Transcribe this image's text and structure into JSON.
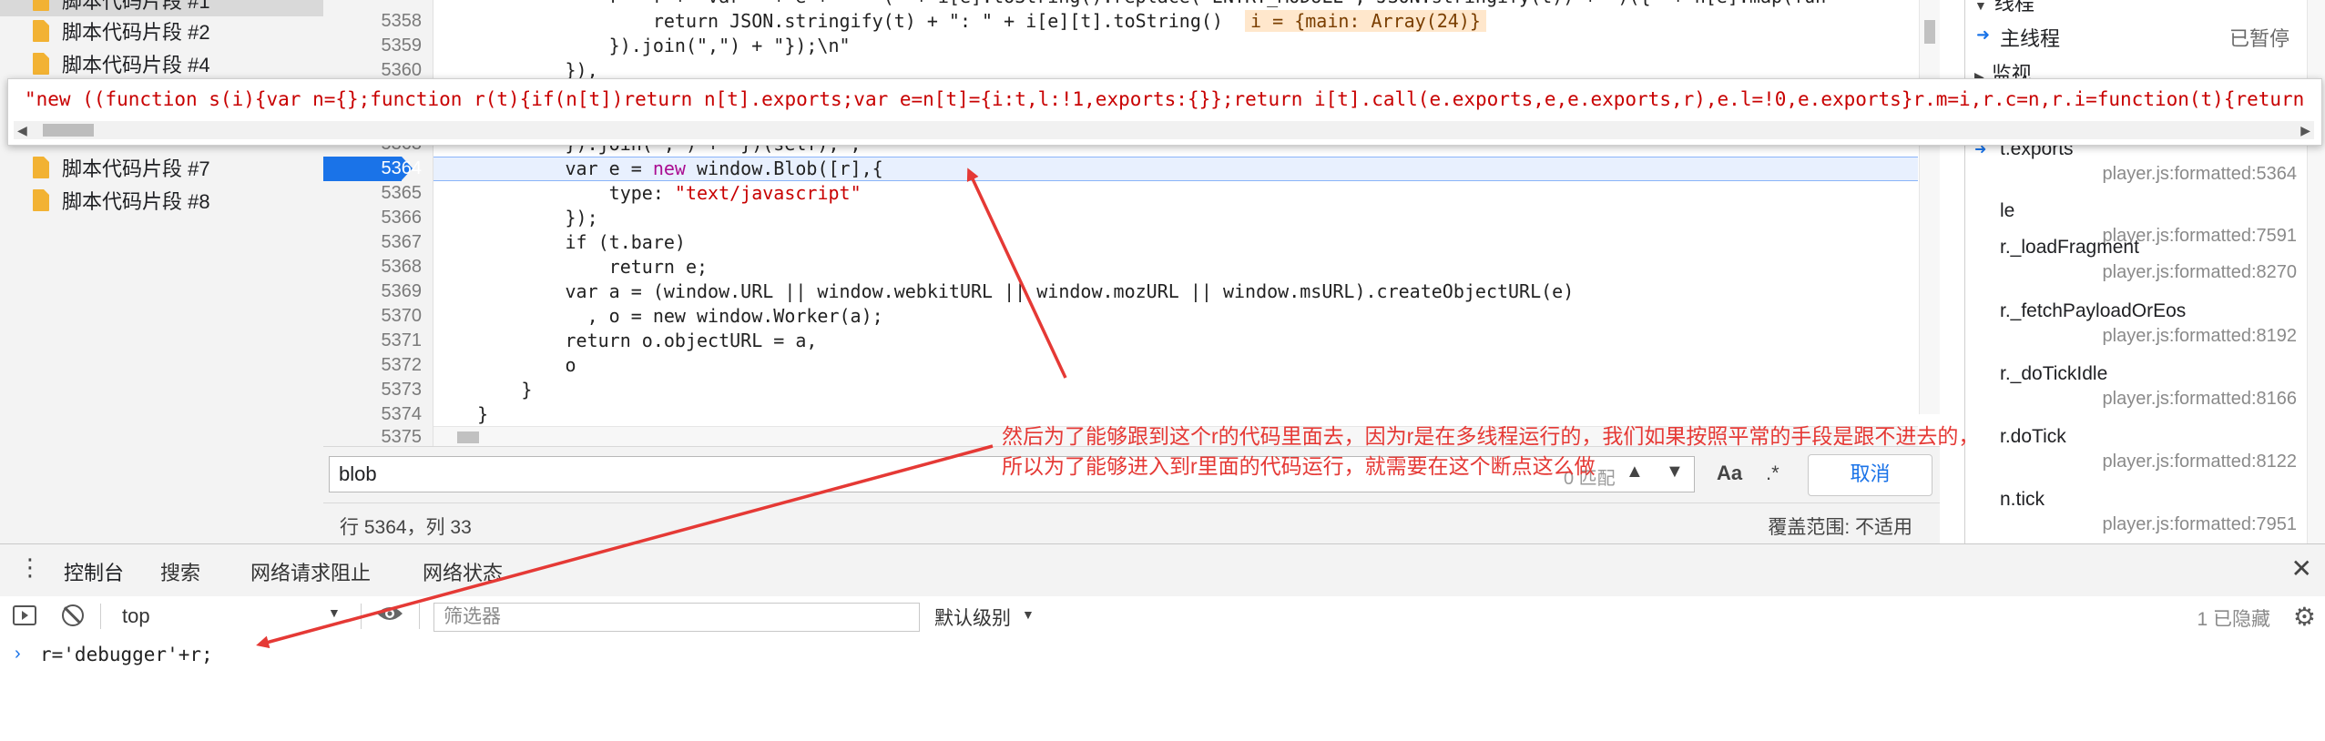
{
  "file_tree": {
    "items": [
      {
        "label": "脚本代码片段 #1"
      },
      {
        "label": "脚本代码片段 #2"
      },
      {
        "label": "脚本代码片段 #4"
      },
      {
        "label": "脚本代码片段 #7"
      },
      {
        "label": "脚本代码片段 #8"
      }
    ]
  },
  "editor": {
    "line_numbers": [
      "5358",
      "5359",
      "5360",
      "5363",
      "5364",
      "5365",
      "5366",
      "5367",
      "5368",
      "5369",
      "5370",
      "5371",
      "5372",
      "5373",
      "5374",
      "5375"
    ],
    "lines": {
      "l5357": "                r = r + 'var ' + e + ' = (' + i[e].toString().replace(\"ENTRY_MODULE\", JSON.stringify(t)) + ')({' + n[e].map(fun",
      "l5358_a": "                    return JSON.stringify(t) + \": \" + i[e][t].toString()",
      "l5358_hint": "i = {main: Array(24)}",
      "l5359": "                }).join(\",\") + \"});\\n\"",
      "l5360": "            }),",
      "l5363": "            }).join(\",\") + \"})(self);\";",
      "l5364_a": "            var e = ",
      "l5364_kw": "new",
      "l5364_b": " window.Blob([r],{",
      "l5365_a": "                type: ",
      "l5365_str": "\"text/javascript\"",
      "l5366": "            });",
      "l5367": "            if (t.bare)",
      "l5368": "                return e;",
      "l5369": "            var a = (window.URL || window.webkitURL || window.mozURL || window.msURL).createObjectURL(e)",
      "l5370": "              , o = new window.Worker(a);",
      "l5371": "            return o.objectURL = a,",
      "l5372": "            o",
      "l5373": "        }",
      "l5374": "    }"
    },
    "breakpoint_line": "5364"
  },
  "tooltip": {
    "text": "\"new ((function s(i){var n={};function r(t){if(n[t])return n[t].exports;var e=n[t]={i:t,l:!1,exports:{}};return i[t].call(e.exports,e,e.exports,r),e.l=!0,e.exports}r.m=i,r.c=n,r.i=function(t){return t},r"
  },
  "search": {
    "value": "blob",
    "count": "0 匹配",
    "match_case": "Aa",
    "regex": ".*",
    "cancel": "取消"
  },
  "status": {
    "cursor": "行 5364，列 33",
    "coverage": "覆盖范围: 不适用"
  },
  "debug_panel": {
    "threads_header": "线程",
    "main_thread": "主线程",
    "main_status": "已暂停",
    "watch_header": "监视",
    "frames": [
      {
        "name": "t.exports",
        "loc": "player.js:formatted:5364"
      },
      {
        "name": "le",
        "loc": "player.js:formatted:7591"
      },
      {
        "name": "r._loadFragment",
        "loc": "player.js:formatted:8270"
      },
      {
        "name": "r._fetchPayloadOrEos",
        "loc": "player.js:formatted:8192"
      },
      {
        "name": "r._doTickIdle",
        "loc": "player.js:formatted:8166"
      },
      {
        "name": "r.doTick",
        "loc": "player.js:formatted:8122"
      },
      {
        "name": "n.tick",
        "loc": "player.js:formatted:7951"
      }
    ]
  },
  "drawer": {
    "tabs": [
      "控制台",
      "搜索",
      "网络请求阻止",
      "网络状态"
    ],
    "active_tab": 0
  },
  "console": {
    "context": "top",
    "filter_placeholder": "筛选器",
    "level": "默认级别",
    "hidden": "1 已隐藏",
    "input": "r='debugger'+r;"
  },
  "annotation": {
    "text": "然后为了能够跟到这个r的代码里面去，因为r是在多线程运行的，我们如果按照平常的手段是跟不进去的，所以为了能够进入到r里面的代码运行，就需要在这个断点这么做"
  },
  "colors": {
    "accent": "#1a73e8",
    "annotation": "#e53935",
    "string": "#c80000",
    "keyword": "#aa0d91"
  }
}
